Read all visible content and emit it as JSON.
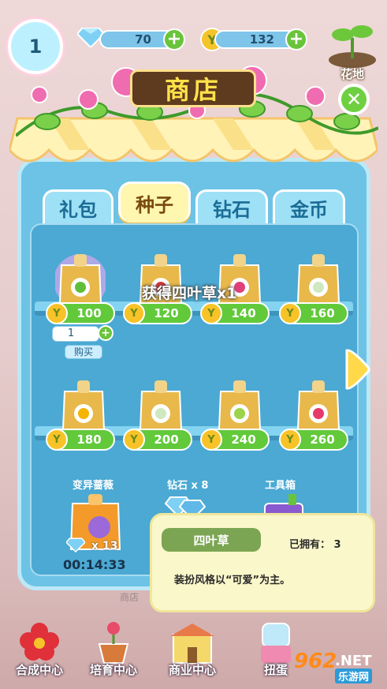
{
  "top_bar": {
    "level": "1",
    "diamonds": "70",
    "seeds": "132",
    "garden_label": "花地"
  },
  "shop": {
    "title": "商店",
    "tabs": [
      {
        "label": "礼包",
        "active": false
      },
      {
        "label": "种子",
        "active": true
      },
      {
        "label": "钻石",
        "active": false
      },
      {
        "label": "金币",
        "active": false
      }
    ],
    "items_row1": [
      {
        "price": "100",
        "flower_color": "#5fbf3a"
      },
      {
        "price": "120",
        "flower_color": "#d63a3a"
      },
      {
        "price": "140",
        "flower_color": "#e0407a"
      },
      {
        "price": "160",
        "flower_color": "#f0f0f0"
      }
    ],
    "items_row2": [
      {
        "price": "180",
        "flower_color": "#f5b400"
      },
      {
        "price": "200",
        "flower_color": "#f0f0f0"
      },
      {
        "price": "240",
        "flower_color": "#9bd44a"
      },
      {
        "price": "260",
        "flower_color": "#e83a6a"
      }
    ],
    "quantity": "1",
    "buy_label": "购买",
    "toast": "获得四叶草x1",
    "specials": [
      {
        "label": "变异蔷薇",
        "count": "x 13",
        "timer": "00:14:33"
      },
      {
        "label": "钻石 x 8"
      },
      {
        "label": "工具箱"
      }
    ],
    "shop_sign": "商店"
  },
  "tooltip": {
    "name": "四叶草",
    "owned": "已拥有： 3",
    "description": "装扮风格以“可爱”为主。"
  },
  "bottom_nav": [
    {
      "label": "合成中心"
    },
    {
      "label": "培育中心"
    },
    {
      "label": "商业中心"
    },
    {
      "label": "扭蛋"
    }
  ],
  "watermark": {
    "brand": "962",
    "suffix": ".NET",
    "sub": "乐游网"
  },
  "colors": {
    "panel": "#6cc3e6",
    "accent_green": "#62c93b",
    "title_gold": "#ffe24a"
  }
}
